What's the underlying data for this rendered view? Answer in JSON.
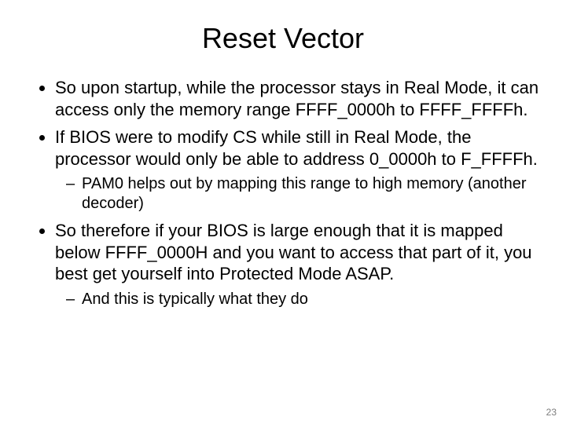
{
  "title": "Reset Vector",
  "bullets": [
    {
      "text": "So upon startup, while the processor stays in Real Mode, it can access only the memory range FFFF_0000h to FFFF_FFFFh.",
      "sub": []
    },
    {
      "text": "If BIOS were to modify CS while still in Real Mode, the processor would only be able to address 0_0000h to F_FFFFh.",
      "sub": [
        "PAM0 helps out by mapping this range to high memory (another decoder)"
      ]
    },
    {
      "text": "So therefore if your BIOS is large enough that it is mapped below FFFF_0000H and you want to access that part of it, you best get yourself into Protected Mode ASAP.",
      "sub": [
        "And this is typically what they do"
      ]
    }
  ],
  "page_number": "23"
}
